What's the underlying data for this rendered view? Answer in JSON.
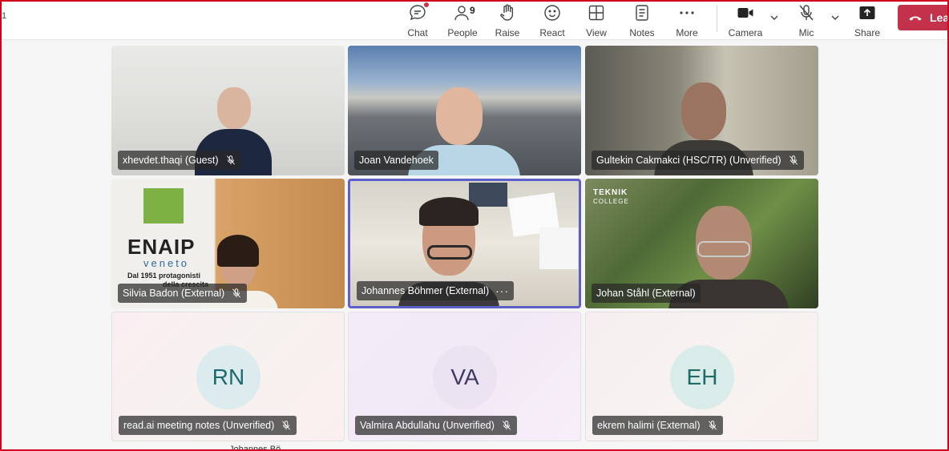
{
  "toolbar": {
    "edge_mark": "1",
    "chat_label": "Chat",
    "people_label": "People",
    "people_count": "9",
    "raise_label": "Raise",
    "react_label": "React",
    "view_label": "View",
    "notes_label": "Notes",
    "more_label": "More",
    "camera_label": "Camera",
    "mic_label": "Mic",
    "share_label": "Share",
    "leave_label": "Lea"
  },
  "participants": [
    {
      "name": "xhevdet.thaqi (Guest)",
      "muted": true
    },
    {
      "name": "Joan Vandehoek",
      "muted": false
    },
    {
      "name": "Gultekin Cakmakci (HSC/TR) (Unverified)",
      "muted": true
    },
    {
      "name": "Silvia Badon (External)",
      "muted": true
    },
    {
      "name": "Johannes Böhmer (External)",
      "muted": false,
      "speaking": true
    },
    {
      "name": "Johan Ståhl (External)",
      "muted": false
    },
    {
      "name": "read.ai meeting notes (Unverified)",
      "muted": true,
      "initials": "RN"
    },
    {
      "name": "Valmira Abdullahu (Unverified)",
      "muted": true,
      "initials": "VA"
    },
    {
      "name": "ekrem halimi (External)",
      "muted": true,
      "initials": "EH"
    }
  ],
  "enaip": {
    "logo": "ENAIP",
    "sub": "veneto",
    "tagline1": "Dal 1951 protagonisti",
    "tagline2": "della crescita"
  },
  "teknik": {
    "line1": "TEKNIK",
    "line2": "COLLEGE"
  },
  "bottom": {
    "partial_name": "Johannes Bö..."
  },
  "colors": {
    "accent": "#5b5fc7",
    "leave": "#c4314b",
    "notification": "#d13438"
  }
}
